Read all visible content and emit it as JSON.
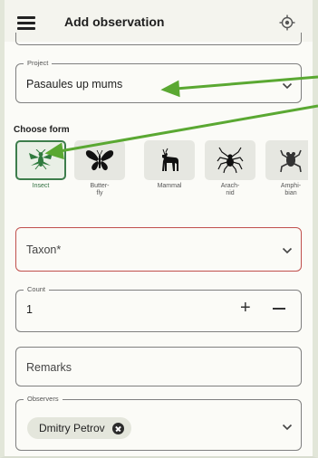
{
  "header": {
    "title": "Add observation",
    "menu_icon": "menu-icon",
    "location_icon": "gps-crosshair-icon"
  },
  "project": {
    "legend": "Project",
    "value": "Pasaules up mums"
  },
  "choose_form": {
    "heading": "Choose form"
  },
  "forms": [
    {
      "label": "Insect",
      "icon": "insect-icon",
      "selected": true
    },
    {
      "label": "Butter-\nfly",
      "icon": "butterfly-icon",
      "selected": false
    },
    {
      "label": "Mammal",
      "icon": "deer-icon",
      "selected": false
    },
    {
      "label": "Arach-\nnid",
      "icon": "spider-icon",
      "selected": false
    },
    {
      "label": "Amphi-\nbian",
      "icon": "frog-icon",
      "selected": false
    }
  ],
  "taxon": {
    "placeholder": "Taxon*"
  },
  "count": {
    "legend": "Count",
    "value": "1",
    "plus": "+",
    "minus": "−"
  },
  "remarks": {
    "placeholder": "Remarks"
  },
  "observers": {
    "legend": "Observers",
    "chip": "Dmitry Petrov"
  },
  "colors": {
    "accent": "#3d7d4c",
    "error": "#c0504d",
    "annotation_arrow": "#5aa832"
  }
}
